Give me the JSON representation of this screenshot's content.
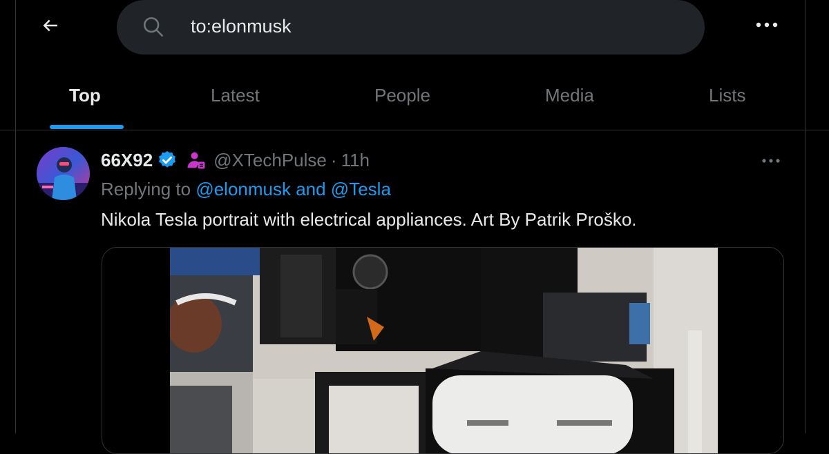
{
  "search": {
    "query": "to:elonmusk"
  },
  "tabs": [
    {
      "label": "Top",
      "active": true
    },
    {
      "label": "Latest",
      "active": false
    },
    {
      "label": "People",
      "active": false
    },
    {
      "label": "Media",
      "active": false
    },
    {
      "label": "Lists",
      "active": false
    }
  ],
  "tweet": {
    "display_name": "66X92",
    "handle": "@XTechPulse",
    "separator": "·",
    "time": "11h",
    "replying_prefix": "Replying to",
    "replying_mentions": "@elonmusk and @Tesla",
    "text": "Nikola Tesla portrait with electrical appliances. Art By Patrik Proško."
  },
  "icons": {
    "back": "arrow-left-icon",
    "search": "search-icon",
    "more": "more-horizontal-icon",
    "verified": "verified-badge-icon",
    "affiliate": "affiliate-person-icon"
  },
  "colors": {
    "accent": "#1d9bf0",
    "background": "#000000",
    "search_bg": "#202327",
    "muted_text": "#71767b",
    "primary_text": "#e7e9ea",
    "affiliate": "#c936cc"
  }
}
